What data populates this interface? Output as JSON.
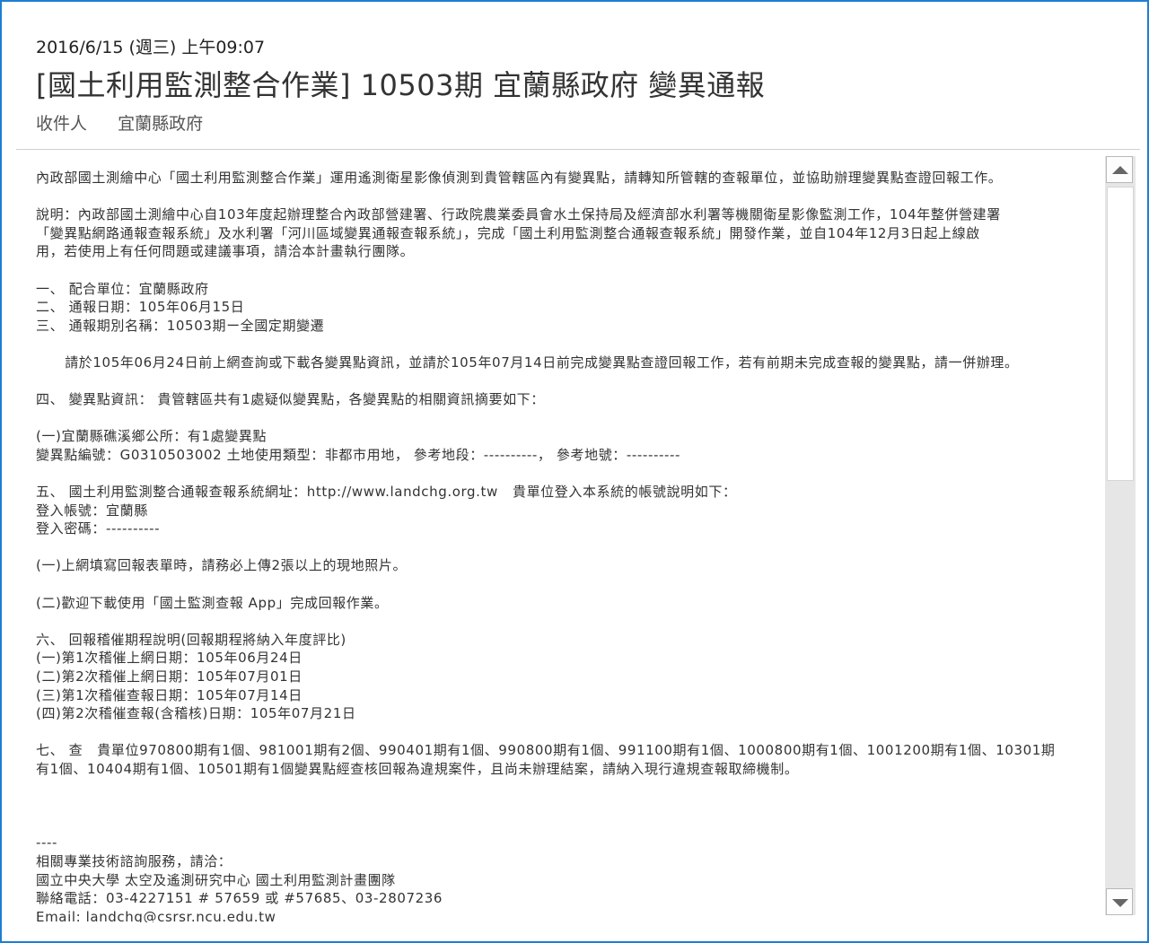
{
  "header": {
    "date": "2016/6/15 (週三) 上午09:07",
    "subject": "[國土利用監測整合作業] 10503期 宜蘭縣政府 變異通報",
    "recipient_label": "收件人",
    "recipient_value": "宜蘭縣政府"
  },
  "body": {
    "lines": [
      "內政部國土測繪中心「國土利用監測整合作業」運用遙測衛星影像偵測到貴管轄區內有變異點，請轉知所管轄的查報單位，並協助辦理變異點查證回報工作。",
      "",
      "說明：內政部國土測繪中心自103年度起辦理整合內政部營建署、行政院農業委員會水土保持局及經濟部水利署等機關衛星影像監測工作，104年整併營建署",
      "「變異點網路通報查報系統」及水利署「河川區域變異通報查報系統」，完成「國土利用監測整合通報查報系統」開發作業，並自104年12月3日起上線啟",
      "用，若使用上有任何問題或建議事項，請洽本計畫執行團隊。",
      "",
      "一、 配合單位：宜蘭縣政府",
      "二、 通報日期：105年06月15日",
      "三、 通報期別名稱：10503期ー全國定期變遷",
      "",
      "      請於105年06月24日前上網查詢或下載各變異點資訊，並請於105年07月14日前完成變異點查證回報工作，若有前期未完成查報的變異點，請一併辦理。",
      "",
      "四、 變異點資訊： 貴管轄區共有1處疑似變異點，各變異點的相關資訊摘要如下：",
      "",
      "(一)宜蘭縣礁溪鄉公所：有1處變異點",
      "變異點編號：G0310503002 土地使用類型：非都市用地， 參考地段：----------， 參考地號：----------",
      "",
      "五、 國土利用監測整合通報查報系統網址：http://www.landchg.org.tw   貴單位登入本系統的帳號說明如下：",
      "登入帳號：宜蘭縣",
      "登入密碼：----------",
      "",
      "(一)上網填寫回報表單時，請務必上傳2張以上的現地照片。",
      "",
      "(二)歡迎下載使用「國土監測查報 App」完成回報作業。",
      "",
      "六、 回報稽催期程說明(回報期程將納入年度評比)",
      "(一)第1次稽催上網日期：105年06月24日",
      "(二)第2次稽催上網日期：105年07月01日",
      "(三)第1次稽催查報日期：105年07月14日",
      "(四)第2次稽催查報(含稽核)日期：105年07月21日",
      "",
      "七、 查   貴單位970800期有1個、981001期有2個、990401期有1個、990800期有1個、991100期有1個、1000800期有1個、1001200期有1個、10301期",
      "有1個、10404期有1個、10501期有1個變異點經查核回報為違規案件，且尚未辦理結案，請納入現行違規查報取締機制。",
      "",
      "",
      "",
      "----",
      "相關專業技術諮詢服務，請洽：",
      "國立中央大學 太空及遙測研究中心 國土利用監測計畫團隊",
      "聯絡電話：03-4227151 # 57659 或 #57685、03-2807236",
      "Email: landchg@csrsr.ncu.edu.tw"
    ]
  },
  "scrollbar": {
    "up_icon": "triangle-up",
    "down_icon": "triangle-down",
    "position": 0.0,
    "visible_fraction": 0.4
  },
  "colors": {
    "window_border": "#1e7ed2",
    "text": "#333333",
    "scroll_track": "#e6e6e6"
  }
}
